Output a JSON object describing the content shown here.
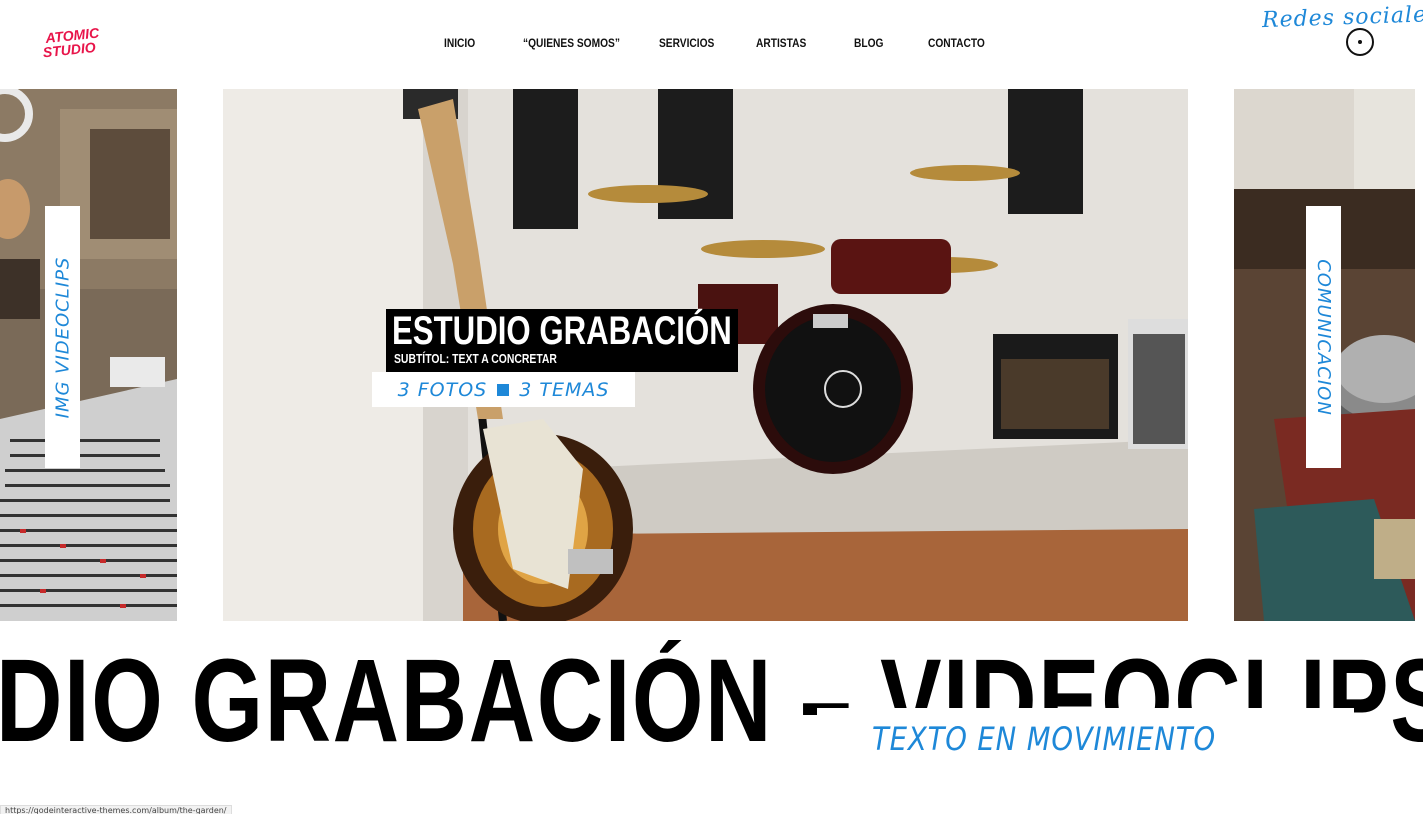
{
  "brand": {
    "logo_line1": "ATOMIC",
    "logo_line2": "STUDIO",
    "accent": "#e8154a"
  },
  "nav": {
    "items": [
      {
        "label": "INICIO"
      },
      {
        "label": "“QUIENES SOMOS”"
      },
      {
        "label": "SERVICIOS"
      },
      {
        "label": "ARTISTAS"
      },
      {
        "label": "BLOG"
      },
      {
        "label": "CONTACTO"
      }
    ]
  },
  "social": {
    "label": "Redes sociales"
  },
  "slider": {
    "left_tab": "IMG VIDEOCLIPS",
    "right_tab": "COMUNICACION",
    "center": {
      "title": "ESTUDIO GRABACIÓN",
      "subtitle": "SUBTÍTOL: TEXT A CONCRETAR",
      "meta_photos": "3 FOTOS",
      "meta_themes": "3 TEMAS"
    }
  },
  "marquee": {
    "text": "UDIO GRABACIÓN – VIDEOCLIPS – M"
  },
  "moving_label": "TEXTO EN MOVIMIENTO",
  "status_bar": {
    "url": "https://qodeinteractive-themes.com/album/the-garden/"
  },
  "colors": {
    "blue": "#1e88d8",
    "black": "#000000",
    "white": "#ffffff"
  }
}
